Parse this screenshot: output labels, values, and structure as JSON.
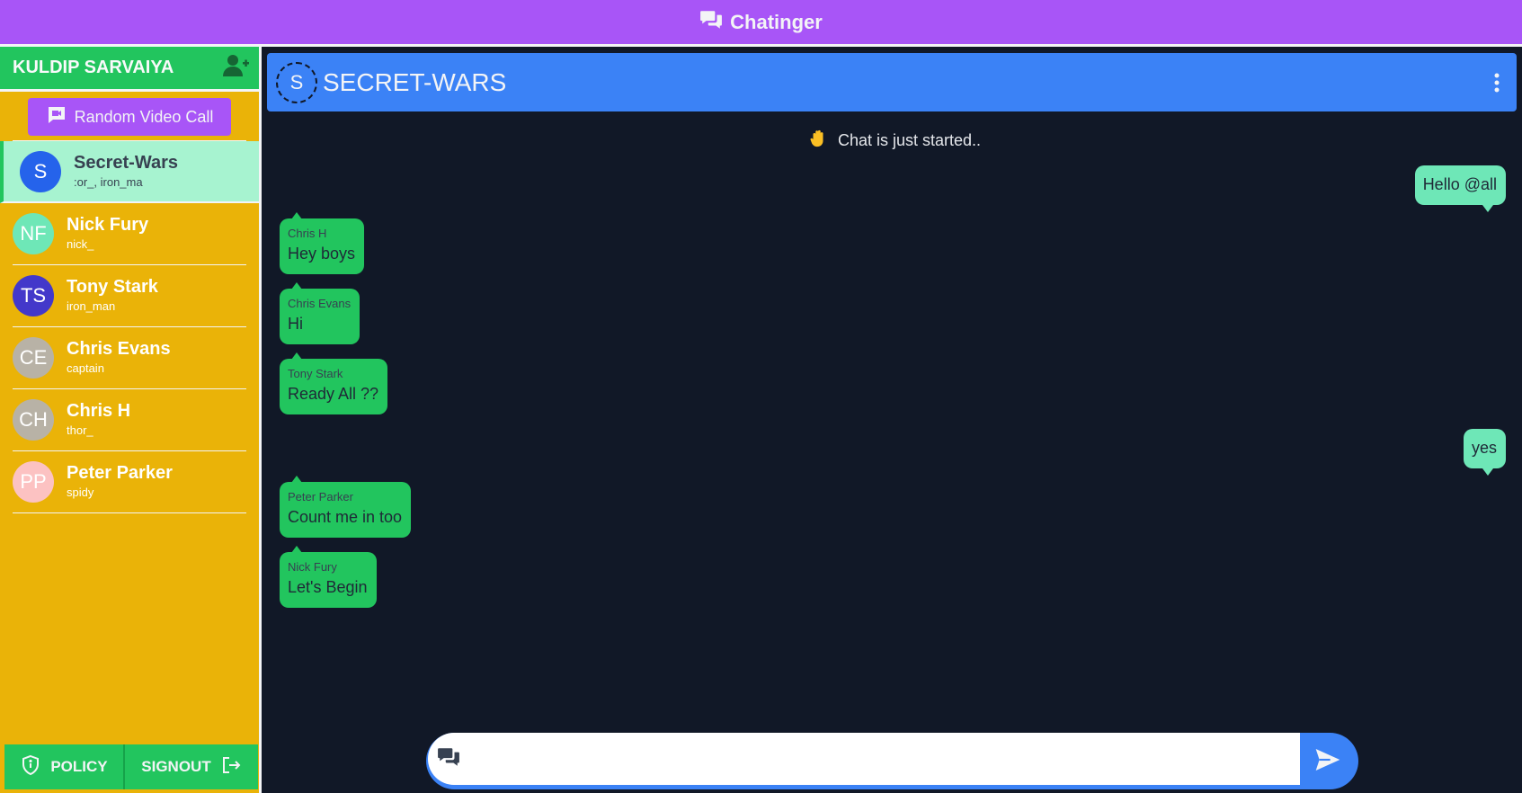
{
  "app": {
    "title": "Chatinger"
  },
  "sidebar": {
    "user_name": "KULDIP SARVAIYA",
    "add_user_icon": "user-plus-icon",
    "random_video_call_label": "Random Video Call",
    "contacts": [
      {
        "initials": "S",
        "name": "Secret-Wars",
        "sub": ":or_, iron_ma",
        "color": "#2563eb",
        "active": true
      },
      {
        "initials": "NF",
        "name": "Nick Fury",
        "sub": "nick_",
        "color": "#6ee7b7"
      },
      {
        "initials": "TS",
        "name": "Tony Stark",
        "sub": "iron_man",
        "color": "#4338ca"
      },
      {
        "initials": "CE",
        "name": "Chris Evans",
        "sub": "captain",
        "color": "#b8b2a6"
      },
      {
        "initials": "CH",
        "name": "Chris H",
        "sub": "thor_",
        "color": "#b8b2a6"
      },
      {
        "initials": "PP",
        "name": "Peter Parker",
        "sub": "spidy",
        "color": "#fcc2c2"
      }
    ],
    "policy_label": "POLICY",
    "signout_label": "SIGNOUT"
  },
  "chat": {
    "group_initial": "S",
    "group_name": "SECRET-WARS",
    "system_message": "Chat is just started..",
    "messages": [
      {
        "direction": "out",
        "text": "Hello @all"
      },
      {
        "direction": "in",
        "sender": "Chris H",
        "text": "Hey boys"
      },
      {
        "direction": "in",
        "sender": "Chris Evans",
        "text": "Hi"
      },
      {
        "direction": "in",
        "sender": "Tony Stark",
        "text": "Ready All ??"
      },
      {
        "direction": "out",
        "text": "yes"
      },
      {
        "direction": "in",
        "sender": "Peter Parker",
        "text": "Count me in too"
      },
      {
        "direction": "in",
        "sender": "Nick Fury",
        "text": "Let's Begin"
      }
    ],
    "input_placeholder": "",
    "input_value": ""
  },
  "colors": {
    "topbar": "#a855f7",
    "sidebar": "#eab308",
    "accent_green": "#22c55e",
    "chat_bg": "#111827",
    "header_blue": "#3b82f6"
  }
}
